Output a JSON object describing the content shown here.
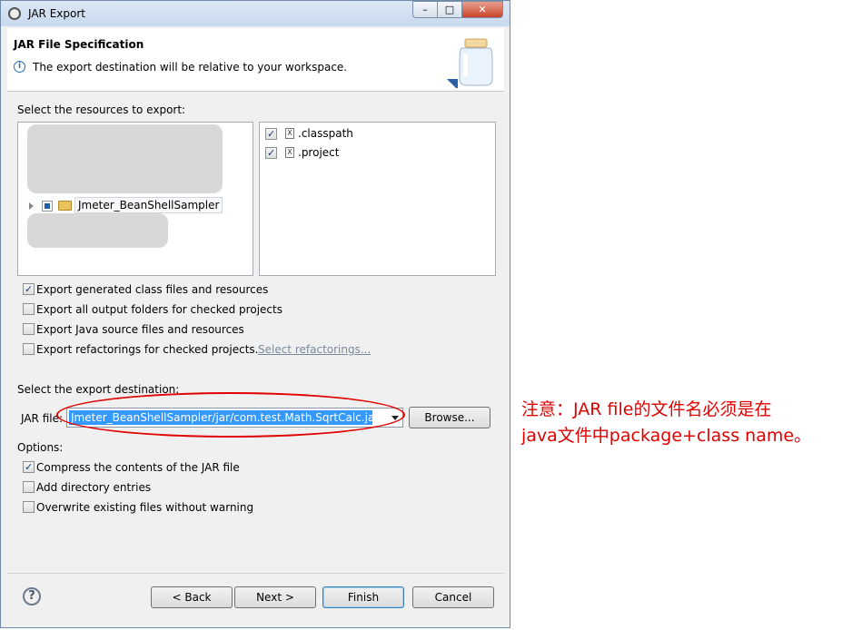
{
  "window": {
    "title": "JAR Export",
    "controls": {
      "minimize": "–",
      "maximize": "□",
      "close": "✕"
    }
  },
  "header": {
    "title": "JAR File Specification",
    "message": "The export destination will be relative to your workspace."
  },
  "resources": {
    "label": "Select the resources to export:",
    "tree_items": [
      {
        "label": "Jmeter_BeanShellSampler"
      }
    ],
    "files": [
      {
        "label": ".classpath",
        "checked": true
      },
      {
        "label": ".project",
        "checked": true
      }
    ]
  },
  "options_top": [
    {
      "label": "Export generated class files and resources",
      "checked": true
    },
    {
      "label": "Export all output folders for checked projects",
      "checked": false
    },
    {
      "label": "Export Java source files and resources",
      "checked": false
    },
    {
      "label": "Export refactorings for checked projects.",
      "checked": false
    }
  ],
  "select_refactorings_link": "Select refactorings...",
  "destination": {
    "label": "Select the export destination:",
    "jar_label": "JAR file:",
    "jar_value": "Jmeter_BeanShellSampler/jar/com.test.Math.SqrtCalc.jar",
    "browse_label": "Browse..."
  },
  "options": {
    "label": "Options:",
    "items": [
      {
        "label": "Compress the contents of the JAR file",
        "checked": true
      },
      {
        "label": "Add directory entries",
        "checked": false
      },
      {
        "label": "Overwrite existing files without warning",
        "checked": false
      }
    ]
  },
  "footer": {
    "back": "< Back",
    "next": "Next >",
    "finish": "Finish",
    "cancel": "Cancel",
    "help": "?"
  },
  "annotation": {
    "line1": "注意：JAR file的文件名必须是在",
    "line2": "java文件中package+class name。"
  },
  "colors": {
    "annotation": "#e00000",
    "selection": "#3399ff"
  },
  "icons": {
    "help": "help-icon",
    "info": "info-icon",
    "jar": "jar-icon",
    "folder": "folder-icon"
  }
}
